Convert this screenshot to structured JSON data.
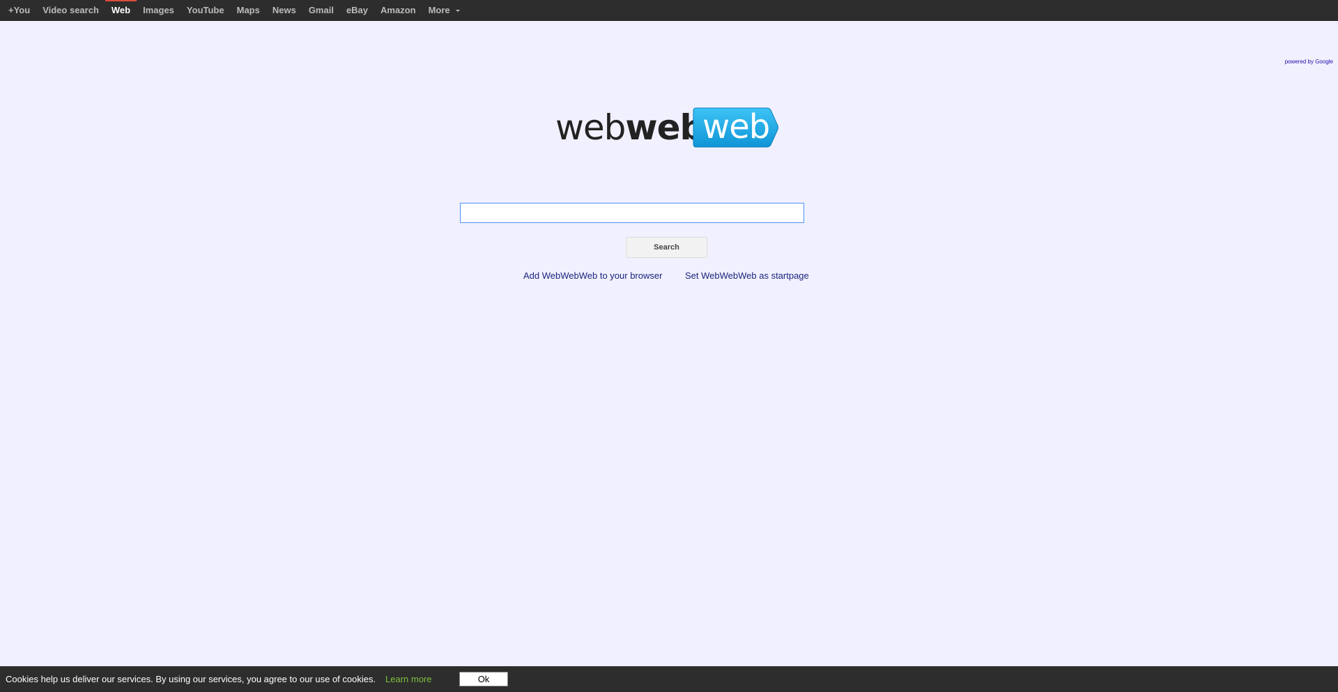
{
  "nav": {
    "items": [
      {
        "label": "+You"
      },
      {
        "label": "Video search"
      },
      {
        "label": "Web"
      },
      {
        "label": "Images"
      },
      {
        "label": "YouTube"
      },
      {
        "label": "Maps"
      },
      {
        "label": "News"
      },
      {
        "label": "Gmail"
      },
      {
        "label": "eBay"
      },
      {
        "label": "Amazon"
      },
      {
        "label": "More"
      }
    ],
    "active": "Web",
    "more_icon": "caret-down-icon"
  },
  "powered_by": "powered by Google",
  "logo": {
    "part1": "web",
    "part2": "web",
    "part3": "web"
  },
  "search": {
    "value": "",
    "placeholder": "",
    "button_label": "Search"
  },
  "links": {
    "add_to_browser": "Add WebWebWeb to your browser",
    "set_startpage": "Set WebWebWeb as startpage"
  },
  "cookie_bar": {
    "message": "Cookies help us deliver our services. By using our services, you agree to our use of cookies.",
    "learn_more": "Learn more",
    "ok_label": "Ok"
  },
  "colors": {
    "background": "#f1f0fe",
    "topbar": "#2d2d2d",
    "active_indicator": "#dd4b39",
    "logo_blue": "#1aa7e6",
    "link": "#1a237e",
    "learn_more": "#7fbf3f"
  }
}
